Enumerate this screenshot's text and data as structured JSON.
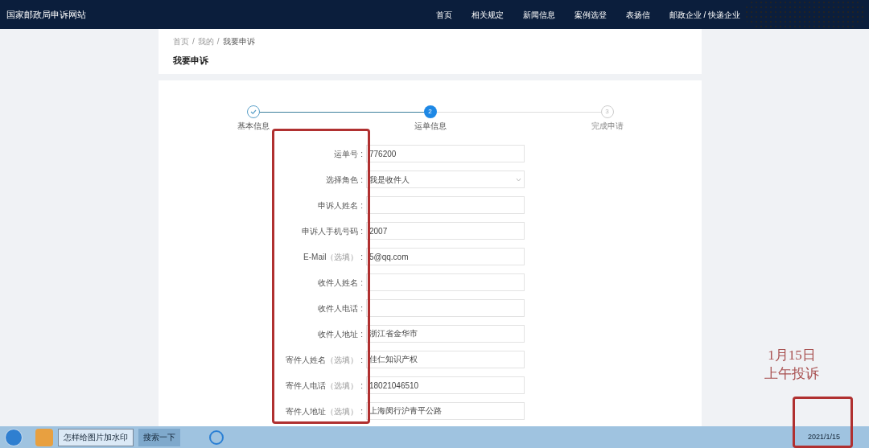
{
  "site_title": "国家邮政局申诉网站",
  "nav": [
    {
      "label": "首页"
    },
    {
      "label": "相关规定"
    },
    {
      "label": "新闻信息"
    },
    {
      "label": "案例选登"
    },
    {
      "label": "表扬信"
    },
    {
      "label": "邮政企业 / 快递企业"
    }
  ],
  "breadcrumb": {
    "items": [
      "首页",
      "我的",
      "我要申诉"
    ],
    "separators": [
      "/",
      "/"
    ]
  },
  "page_title": "我要申诉",
  "steps": [
    {
      "label": "基本信息",
      "kind": "done"
    },
    {
      "label": "运单信息",
      "kind": "current",
      "number": "2"
    },
    {
      "label": "完成申请",
      "kind": "todo",
      "number": "3"
    }
  ],
  "form": [
    {
      "label": "运单号",
      "colon": ":",
      "value": "776200",
      "kind": "text"
    },
    {
      "label": "选择角色",
      "colon": ":",
      "value": "我是收件人",
      "kind": "select"
    },
    {
      "label": "申诉人姓名",
      "colon": ":",
      "kind": "text"
    },
    {
      "label": "申诉人手机号码",
      "colon": ":",
      "value": "2007",
      "kind": "text"
    },
    {
      "label": "E-Mail",
      "optional": "（选填）",
      "colon": ":",
      "value": "5@qq.com",
      "kind": "text"
    },
    {
      "label": "收件人姓名",
      "colon": ":",
      "kind": "text"
    },
    {
      "label": "收件人电话",
      "colon": ":",
      "kind": "text"
    },
    {
      "label": "收件人地址",
      "colon": ":",
      "value": "浙江省金华市",
      "kind": "text"
    },
    {
      "label": "寄件人姓名",
      "optional": "（选填）",
      "colon": ":",
      "value": "佳仁知识产权",
      "kind": "text"
    },
    {
      "label": "寄件人电话",
      "optional": "（选填）",
      "colon": ":",
      "value": "18021046510",
      "kind": "text"
    },
    {
      "label": "寄件人地址",
      "optional": "（选填）",
      "colon": ":",
      "value": "上海闵行沪青平公路",
      "kind": "text"
    }
  ],
  "annotation": {
    "lines": [
      "1月15日",
      "上午投诉"
    ]
  },
  "taskbar": {
    "items": [
      {
        "label": "怎样给图片加水印",
        "selected": true
      },
      {
        "label": "搜索一下",
        "selected": false
      }
    ],
    "date": "2021/1/15"
  }
}
